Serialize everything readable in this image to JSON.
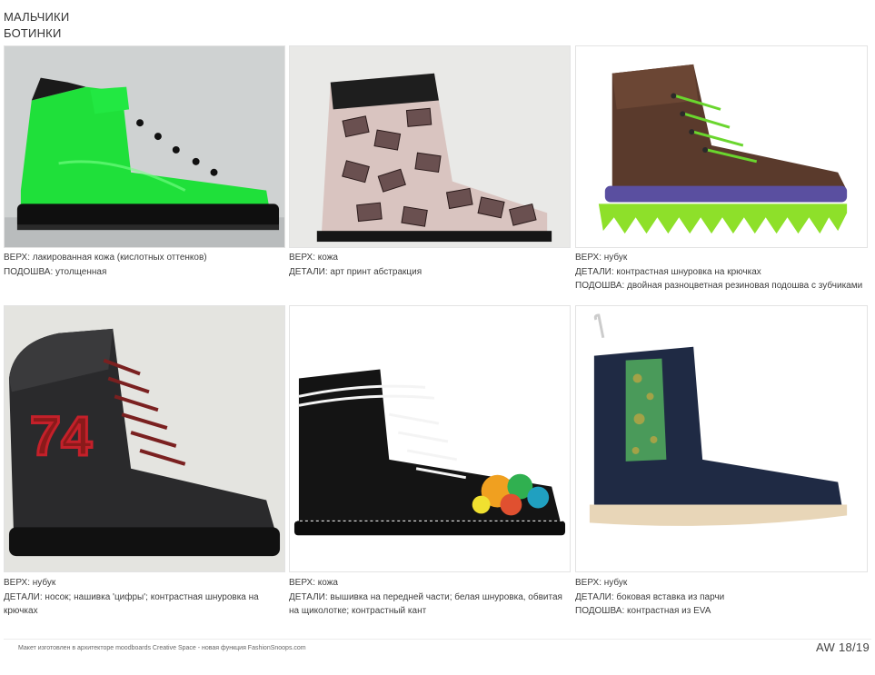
{
  "header": {
    "line1": "МАЛЬЧИКИ",
    "line2": "БОТИНКИ"
  },
  "cards": [
    {
      "image_subject": "green-patent-sneaker-boot",
      "captions": [
        "ВЕРХ: лакированная кожа (кислотных оттенков)",
        "ПОДОШВА: утолщенная"
      ]
    },
    {
      "image_subject": "art-print-eye-boot",
      "captions": [
        "ВЕРХ: кожа",
        "ДЕТАЛИ: арт принт абстракция"
      ]
    },
    {
      "image_subject": "brown-nubuck-hiking-boot",
      "captions": [
        "ВЕРХ: нубук",
        "ДЕТАЛИ: контрастная шнуровка на крючках",
        "ПОДОШВА: двойная разноцветная резиновая подошва с зубчиками"
      ]
    },
    {
      "image_subject": "black-74-patch-boot",
      "captions": [
        "ВЕРХ: нубук",
        "ДЕТАЛИ: носок; нашивка 'цифры'; контрастная шнуровка на крючках"
      ]
    },
    {
      "image_subject": "black-leather-embroidered-boot",
      "captions": [
        "ВЕРХ: кожа",
        "ДЕТАЛИ: вышивка на передней части; белая шнуровка, обвитая на щиколотке; контрастный кант"
      ]
    },
    {
      "image_subject": "navy-chelsea-brocade-boot",
      "captions": [
        "ВЕРХ: нубук",
        "ДЕТАЛИ: боковая вставка из парчи",
        "ПОДОШВА: контрастная из EVA"
      ]
    }
  ],
  "footer": {
    "note": "Макет изготовлен в архитекторе moodboards Creative Space - новая функция FashionSnoops.com",
    "season": "AW 18/19"
  },
  "colors": {
    "acid_green": "#1fe03a",
    "sole_lime": "#8ee02a",
    "sole_purple": "#5a4fa0",
    "nubuck_brown": "#5a3a2c",
    "navy": "#1f2a44",
    "brocade": "#4a9a5a",
    "patch_red": "#c4202a"
  }
}
